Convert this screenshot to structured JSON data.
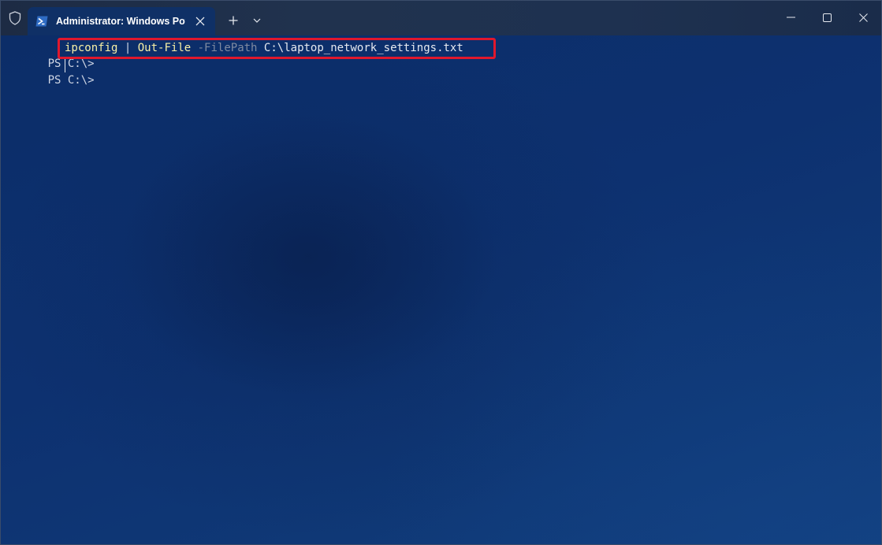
{
  "titlebar": {
    "tab_title": "Administrator: Windows PowerShell",
    "icons": {
      "shield": "shield-icon",
      "tab": "powershell-icon",
      "close_tab": "close-icon",
      "new_tab": "plus-icon",
      "dropdown": "chevron-down-icon",
      "minimize": "minimize-icon",
      "maximize": "maximize-icon",
      "close_window": "close-icon"
    }
  },
  "terminal": {
    "lines": [
      {
        "prompt": "PS C:\\>",
        "command": "ipconfig",
        "pipe": "|",
        "cmdlet": "Out-File",
        "parameter": "-FilePath",
        "argument": "C:\\laptop_network_settings.txt"
      },
      {
        "prompt": "PS C:\\>"
      }
    ],
    "colors": {
      "background": "#0c2f6e",
      "command": "#f9f1a5",
      "parameter": "#7f8aa0",
      "highlight_box": "#e0182d"
    }
  }
}
